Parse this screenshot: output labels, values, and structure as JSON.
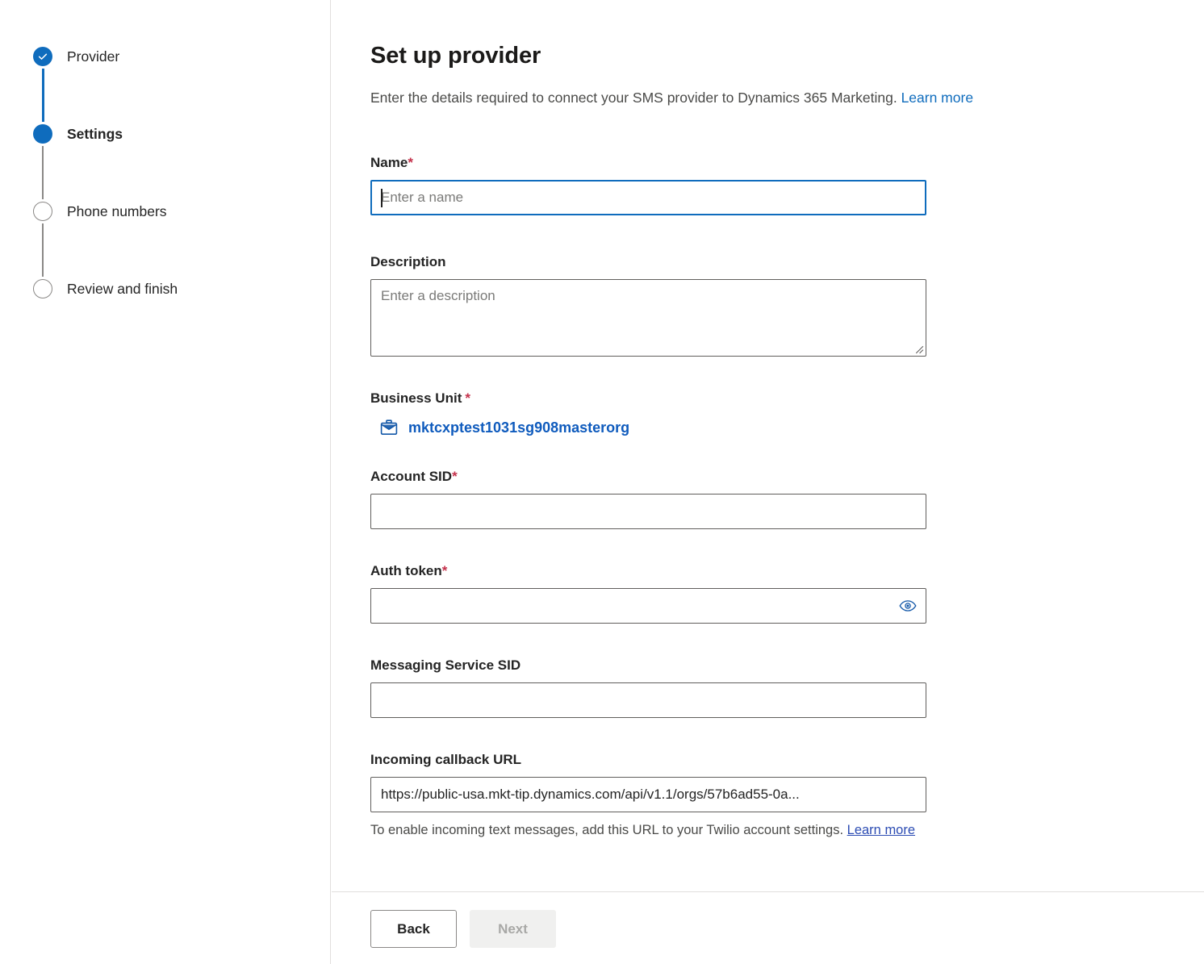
{
  "wizard": {
    "steps": [
      {
        "label": "Provider",
        "state": "completed",
        "icon": "check-icon"
      },
      {
        "label": "Settings",
        "state": "active",
        "icon": "filled-circle-icon"
      },
      {
        "label": "Phone numbers",
        "state": "pending",
        "icon": "empty-circle-icon"
      },
      {
        "label": "Review and finish",
        "state": "pending",
        "icon": "empty-circle-icon"
      }
    ]
  },
  "header": {
    "title": "Set up provider",
    "subtitle": "Enter the details required to connect your SMS provider to Dynamics 365 Marketing.",
    "learn_more": "Learn more"
  },
  "form": {
    "name": {
      "label": "Name",
      "required_marker": "*",
      "placeholder": "Enter a name",
      "value": "",
      "focused": true
    },
    "description": {
      "label": "Description",
      "placeholder": "Enter a description",
      "value": ""
    },
    "business_unit": {
      "label": "Business Unit",
      "required_marker": "*",
      "icon": "briefcase-icon",
      "value": "mktcxptest1031sg908masterorg"
    },
    "account_sid": {
      "label": "Account SID",
      "required_marker": "*",
      "placeholder": "",
      "value": ""
    },
    "auth_token": {
      "label": "Auth token",
      "required_marker": "*",
      "placeholder": "",
      "value": "",
      "reveal_icon": "eye-icon"
    },
    "messaging_service_sid": {
      "label": "Messaging Service SID",
      "placeholder": "",
      "value": ""
    },
    "incoming_callback_url": {
      "label": "Incoming callback URL",
      "value": "https://public-usa.mkt-tip.dynamics.com/api/v1.1/orgs/57b6ad55-0a...",
      "helper_text": "To enable incoming text messages, add this URL to your Twilio account settings.",
      "helper_link": "Learn more"
    }
  },
  "footer": {
    "back_label": "Back",
    "next_label": "Next",
    "next_disabled": true
  },
  "colors": {
    "accent_blue": "#0f6cbd",
    "link_blue": "#0f5bbd",
    "required_red": "#c4314b",
    "border_gray": "#605e5c",
    "divider_gray": "#e1dfdd",
    "disabled_bg": "#f0f0ef",
    "disabled_text": "#a8a8a6"
  }
}
